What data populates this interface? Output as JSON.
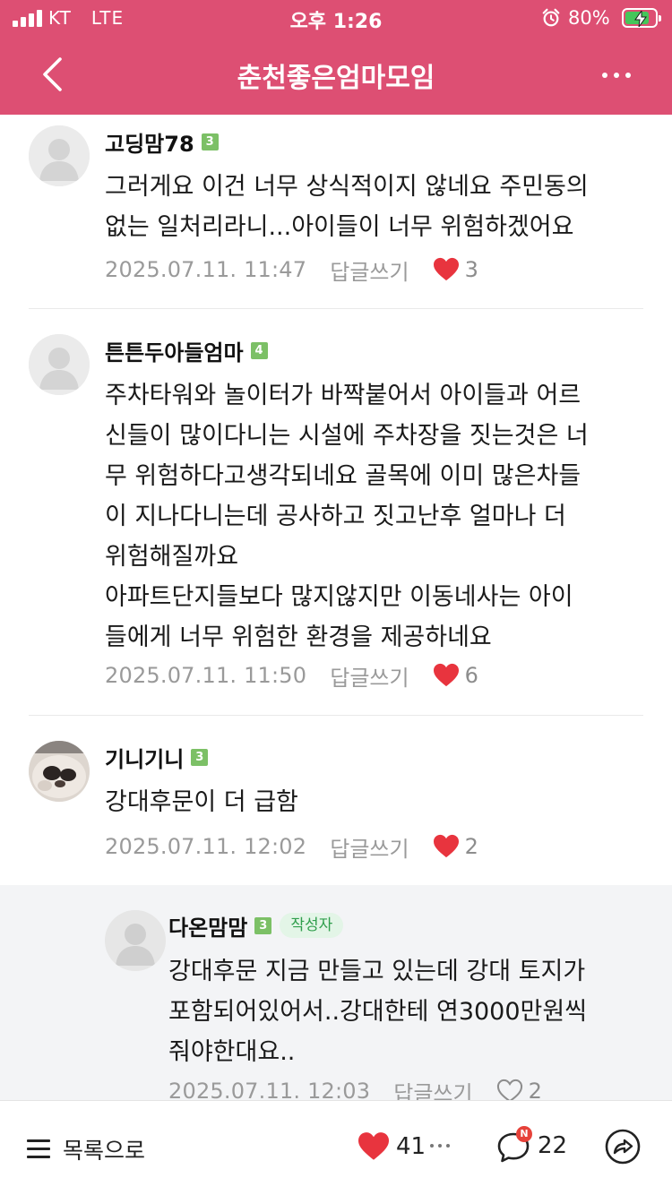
{
  "status_bar": {
    "carrier": "KT",
    "network": "LTE",
    "time": "오후 1:26",
    "battery_percent": "80%",
    "battery_level": 0.8,
    "charging": true
  },
  "header": {
    "title": "춘천좋은엄마모임",
    "background_color": "#dd4f73"
  },
  "comments": [
    {
      "author": "고딩맘78",
      "level": "3",
      "text": "그러게요 이건 너무 상식적이지 않네요 주민동의\n없는 일처리라니...아이들이 너무 위험하겠어요",
      "date": "2025.07.11. 11:47",
      "reply_label": "답글쓰기",
      "likes": "3",
      "liked": true
    },
    {
      "author": "튼튼두아들엄마",
      "level": "4",
      "text": "주차타워와 놀이터가 바짝붙어서 아이들과 어르\n신들이 많이다니는 시설에 주차장을 짓는것은 너\n무 위험하다고생각되네요 골목에 이미 많은차들\n이 지나다니는데 공사하고 짓고난후 얼마나 더\n위험해질까요\n아파트단지들보다 많지않지만 이동네사는 아이\n들에게 너무 위험한 환경을 제공하네요",
      "date": "2025.07.11. 11:50",
      "reply_label": "답글쓰기",
      "likes": "6",
      "liked": true
    },
    {
      "author": "기니기니",
      "level": "3",
      "text": "강대후문이 더 급함",
      "date": "2025.07.11. 12:02",
      "reply_label": "답글쓰기",
      "likes": "2",
      "liked": true
    }
  ],
  "reply": {
    "author": "다온맘맘",
    "level": "3",
    "author_badge": "작성자",
    "text": "강대후문 지금 만들고 있는데 강대 토지가\n포함되어있어서..강대한테 연3000만원씩\n줘야한대요..",
    "date": "2025.07.11. 12:03",
    "reply_label": "답글쓰기",
    "likes": "2",
    "liked": false
  },
  "bottom_bar": {
    "list_label": "목록으로",
    "like_count": "41",
    "comment_count": "22",
    "new_badge": "N"
  },
  "icons": [
    "chevron-left-icon",
    "more-icon",
    "alarm-icon",
    "heart-icon",
    "comment-icon",
    "share-icon",
    "list-icon"
  ]
}
